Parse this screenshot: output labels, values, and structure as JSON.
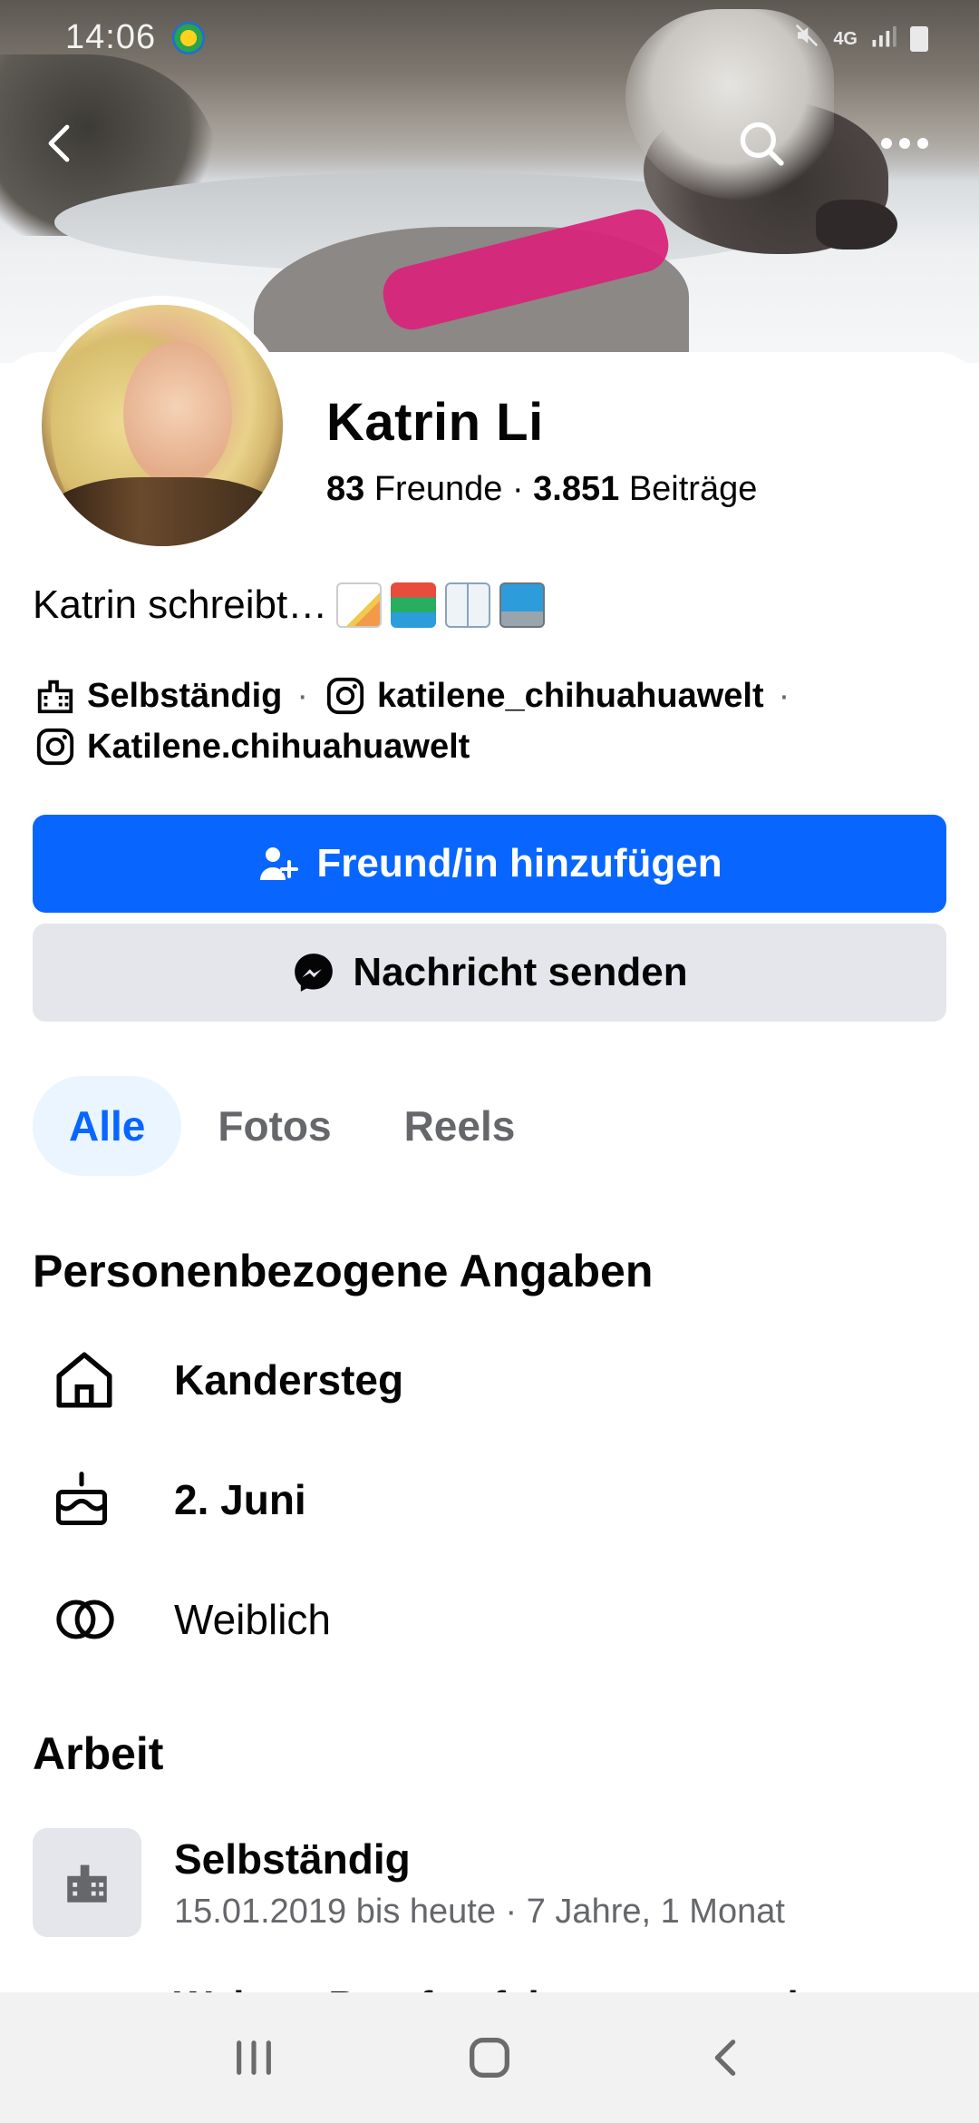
{
  "status_bar": {
    "time": "14:06",
    "network": "4G",
    "icons": [
      "app-notification-icon",
      "mute-icon",
      "network-4g-icon",
      "signal-icon",
      "battery-icon"
    ]
  },
  "top_nav": {
    "icons": [
      "back-arrow-icon",
      "search-icon",
      "more-icon"
    ]
  },
  "profile": {
    "name": "Katrin Li",
    "friends_count": "83",
    "friends_label": "Freunde",
    "dot": "·",
    "posts_count": "3.851",
    "posts_label": "Beiträge",
    "bio": "Katrin schreibt…",
    "bio_emojis": [
      "memo-emoji",
      "books-emoji",
      "open-book-emoji",
      "laptop-emoji"
    ]
  },
  "intro": {
    "line1": [
      {
        "icon": "briefcase-building-icon",
        "text": "Selbständig"
      },
      {
        "icon": "instagram-icon",
        "text": "katilene_chihuahuawelt"
      }
    ],
    "line2": [
      {
        "icon": "instagram-icon",
        "text": "Katilene.chihuahuawelt"
      }
    ],
    "separator": "·"
  },
  "actions": {
    "add_friend": "Freund/in hinzufügen",
    "message": "Nachricht senden"
  },
  "tabs": [
    {
      "label": "Alle",
      "active": true
    },
    {
      "label": "Fotos",
      "active": false
    },
    {
      "label": "Reels",
      "active": false
    }
  ],
  "personal": {
    "title": "Personenbezogene Angaben",
    "items": [
      {
        "icon": "home-icon",
        "text": "Kandersteg",
        "bold": true
      },
      {
        "icon": "birthday-cake-icon",
        "text": "2. Juni",
        "bold": true
      },
      {
        "icon": "gender-icon",
        "text": "Weiblich",
        "bold": false
      }
    ]
  },
  "work": {
    "title": "Arbeit",
    "job_title": "Selbständig",
    "job_sub": "15.01.2019 bis heute · 7 Jahre, 1 Monat",
    "next_peek": "Weitere Berufserfahrungen anzeigen"
  },
  "nav_bar": {
    "icons": [
      "recent-apps-icon",
      "home-button-icon",
      "back-icon"
    ]
  },
  "colors": {
    "primary": "#0866ff",
    "secondary_bg": "#e4e6eb",
    "text": "#050505",
    "muted": "#65676b",
    "tab_active_bg": "#ebf5ff"
  }
}
